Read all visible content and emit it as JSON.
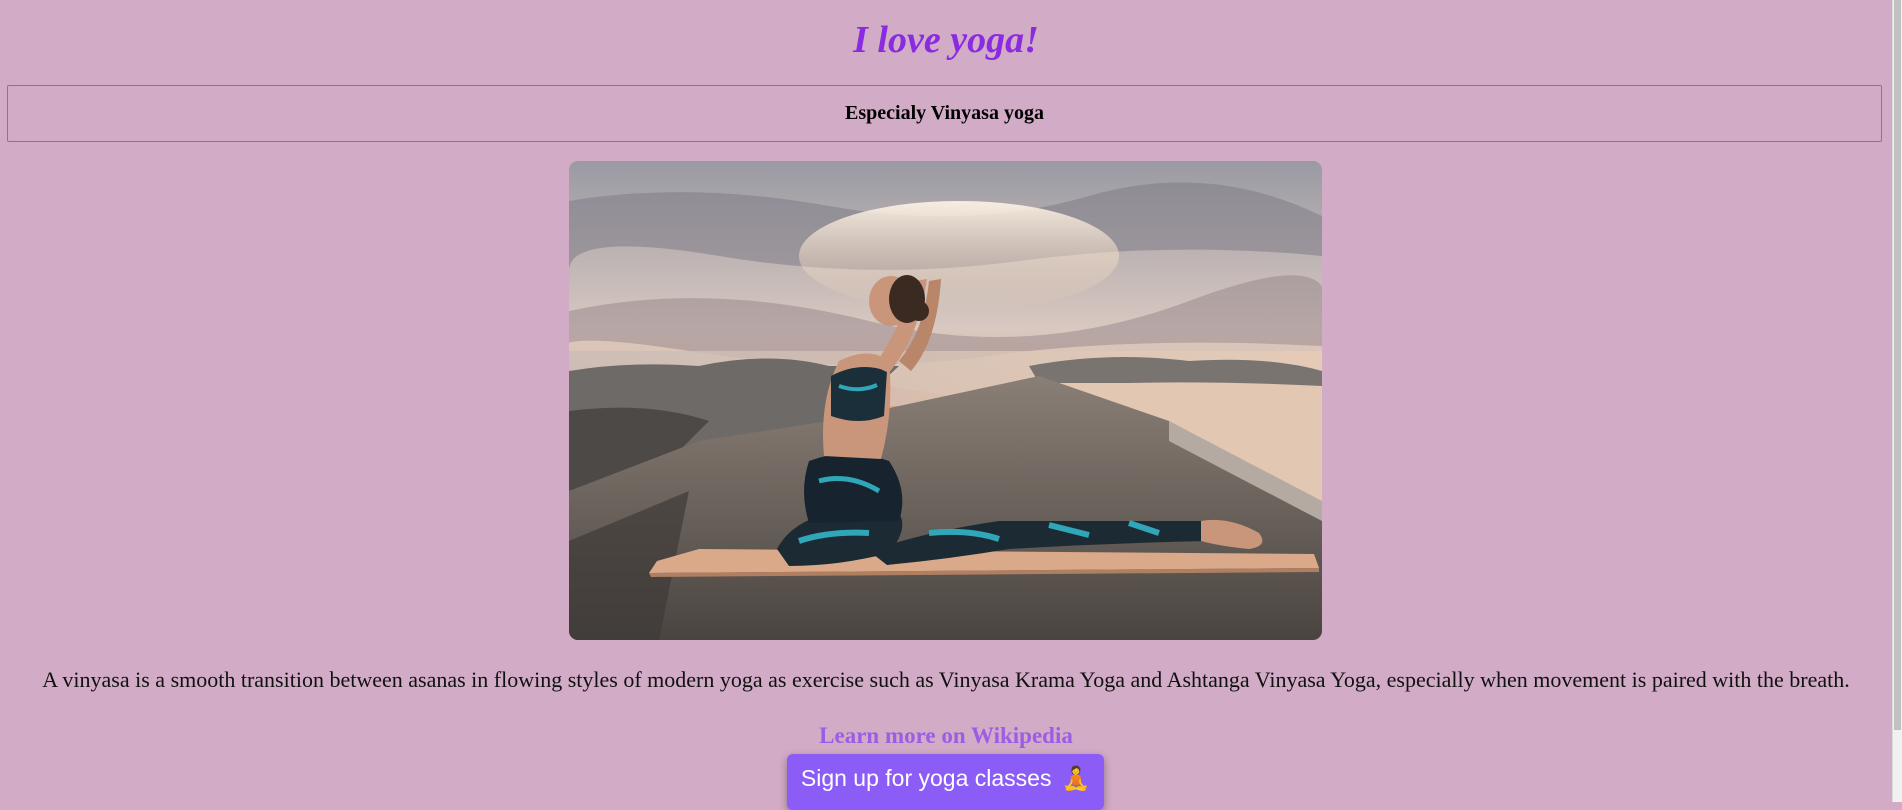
{
  "page": {
    "title": "I love yoga!",
    "subtitle": "Especialy Vinyasa yoga",
    "description": "A vinyasa is a smooth transition between asanas in flowing styles of modern yoga as exercise such as Vinyasa Krama Yoga and Ashtanga Vinyasa Yoga, especially when movement is paired with the breath.",
    "link_text": "Learn more on Wikipedia",
    "button_label": "Sign up for yoga classes",
    "button_emoji": "🧘"
  },
  "image": {
    "subject": "woman in pigeon yoga pose on a mat on a rocky seaside pier at sunset",
    "icon": "yoga-photo"
  },
  "colors": {
    "background": "#d2abc6",
    "title": "#8a2be2",
    "box_border": "#9b5de5",
    "link": "#9b5de5",
    "button": "#8b5cf6"
  }
}
